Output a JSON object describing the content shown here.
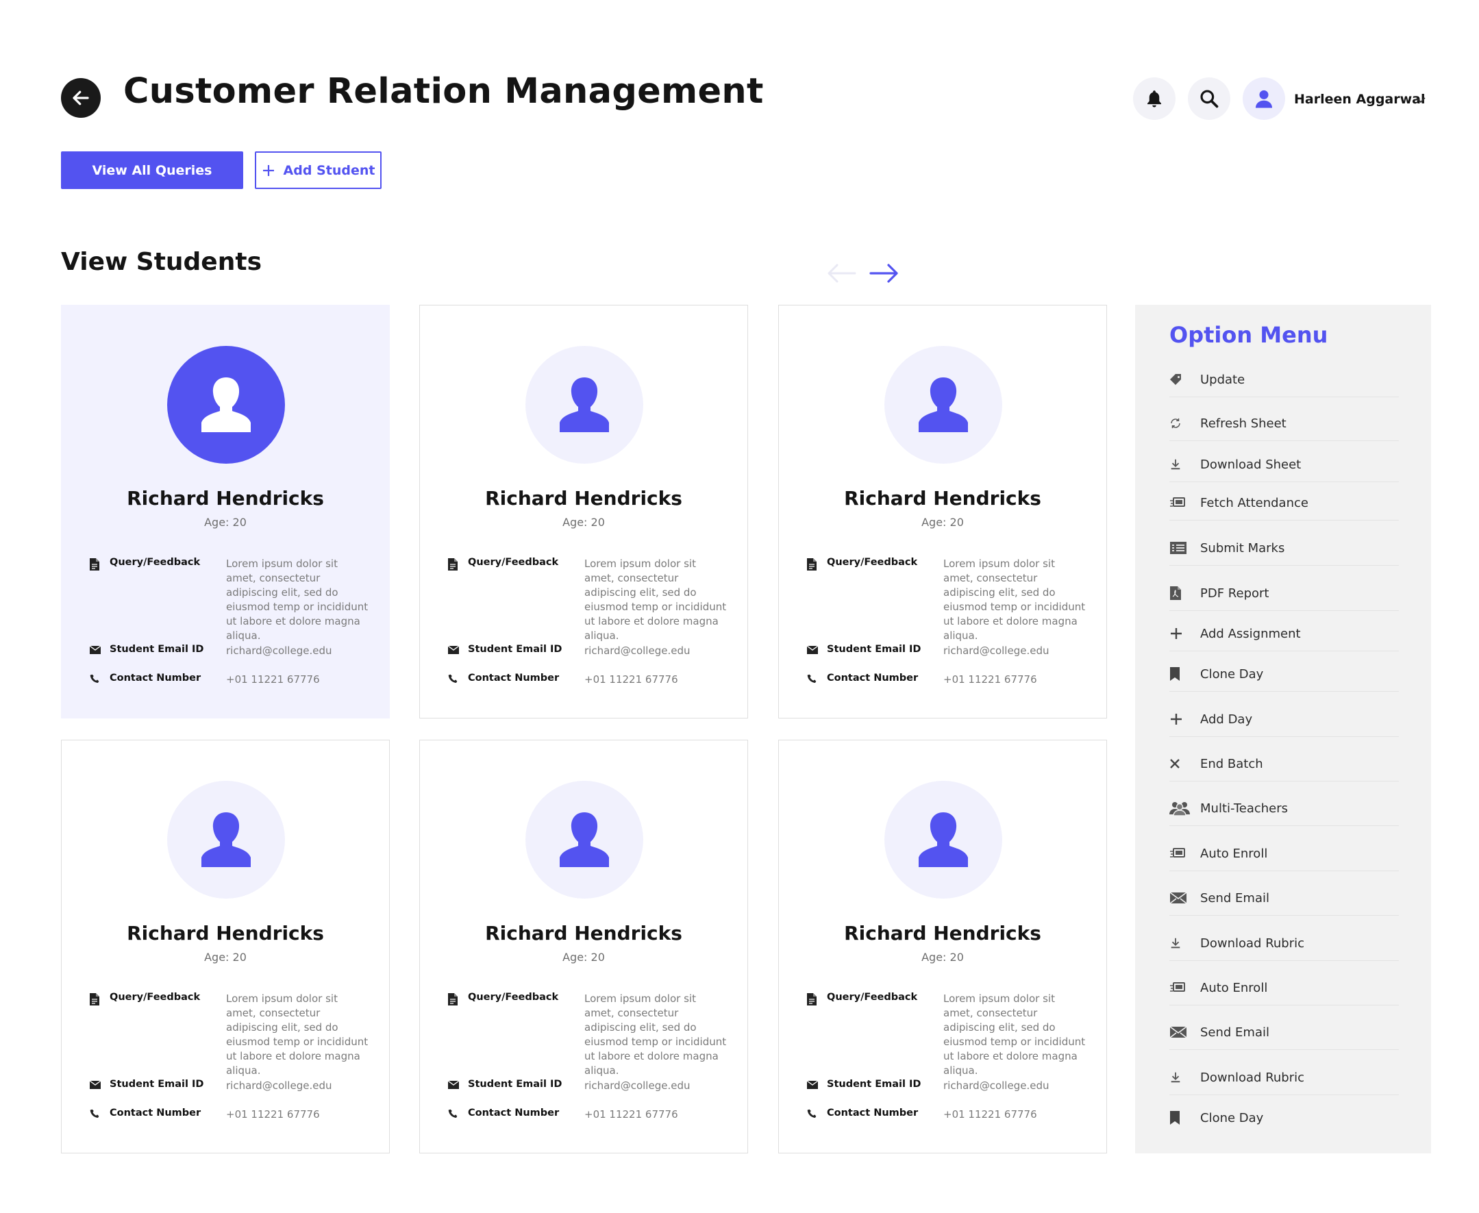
{
  "header": {
    "title": "Customer Relation Management",
    "user_name": "Harleen Aggarwal"
  },
  "actions": {
    "view_all_label": "View All Queries",
    "add_student_label": "Add Student"
  },
  "section_title": "View Students",
  "students": [
    {
      "name": "Richard Hendricks",
      "age": "Age: 20",
      "query_label": "Query/Feedback",
      "query_text": "Lorem ipsum dolor sit amet, consectetur adipiscing elit, sed do eiusmod temp or incididunt ut labore et dolore magna aliqua.",
      "email_label": "Student Email ID",
      "email": "richard@college.edu",
      "phone_label": "Contact Number",
      "phone": "+01 11221 67776"
    },
    {
      "name": "Richard Hendricks",
      "age": "Age: 20",
      "query_label": "Query/Feedback",
      "query_text": "Lorem ipsum dolor sit amet, consectetur adipiscing elit, sed do eiusmod temp or incididunt ut labore et dolore magna aliqua.",
      "email_label": "Student Email ID",
      "email": "richard@college.edu",
      "phone_label": "Contact Number",
      "phone": "+01 11221 67776"
    },
    {
      "name": "Richard Hendricks",
      "age": "Age: 20",
      "query_label": "Query/Feedback",
      "query_text": "Lorem ipsum dolor sit amet, consectetur adipiscing elit, sed do eiusmod temp or incididunt ut labore et dolore magna aliqua.",
      "email_label": "Student Email ID",
      "email": "richard@college.edu",
      "phone_label": "Contact Number",
      "phone": "+01 11221 67776"
    },
    {
      "name": "Richard Hendricks",
      "age": "Age: 20",
      "query_label": "Query/Feedback",
      "query_text": "Lorem ipsum dolor sit amet, consectetur adipiscing elit, sed do eiusmod temp or incididunt ut labore et dolore magna aliqua.",
      "email_label": "Student Email ID",
      "email": "richard@college.edu",
      "phone_label": "Contact Number",
      "phone": "+01 11221 67776"
    },
    {
      "name": "Richard Hendricks",
      "age": "Age: 20",
      "query_label": "Query/Feedback",
      "query_text": "Lorem ipsum dolor sit amet, consectetur adipiscing elit, sed do eiusmod temp or incididunt ut labore et dolore magna aliqua.",
      "email_label": "Student Email ID",
      "email": "richard@college.edu",
      "phone_label": "Contact Number",
      "phone": "+01 11221 67776"
    },
    {
      "name": "Richard Hendricks",
      "age": "Age: 20",
      "query_label": "Query/Feedback",
      "query_text": "Lorem ipsum dolor sit amet, consectetur adipiscing elit, sed do eiusmod temp or incididunt ut labore et dolore magna aliqua.",
      "email_label": "Student Email ID",
      "email": "richard@college.edu",
      "phone_label": "Contact Number",
      "phone": "+01 11221 67776"
    }
  ],
  "option_menu": {
    "title": "Option Menu",
    "items": [
      {
        "label": "Update",
        "icon": "tag-icon"
      },
      {
        "label": "Refresh Sheet",
        "icon": "refresh-icon"
      },
      {
        "label": "Download Sheet",
        "icon": "download-icon"
      },
      {
        "label": "Fetch Attendance",
        "icon": "fetch-icon"
      },
      {
        "label": "Submit Marks",
        "icon": "list-icon"
      },
      {
        "label": "PDF Report",
        "icon": "pdf-icon"
      },
      {
        "label": "Add Assignment",
        "icon": "plus-icon"
      },
      {
        "label": "Clone Day",
        "icon": "bookmark-icon"
      },
      {
        "label": "Add Day",
        "icon": "plus-icon"
      },
      {
        "label": "End Batch",
        "icon": "close-icon"
      },
      {
        "label": "Multi-Teachers",
        "icon": "users-icon"
      },
      {
        "label": "Auto Enroll",
        "icon": "fetch-icon"
      },
      {
        "label": "Send Email",
        "icon": "mail-icon"
      },
      {
        "label": "Download Rubric",
        "icon": "download-icon"
      },
      {
        "label": "Auto Enroll",
        "icon": "fetch-icon"
      },
      {
        "label": "Send Email",
        "icon": "mail-icon"
      },
      {
        "label": "Download Rubric",
        "icon": "download-icon"
      },
      {
        "label": "Clone Day",
        "icon": "bookmark-icon"
      }
    ]
  },
  "colors": {
    "accent": "#5353f0",
    "active_card_bg": "#f2f2fe",
    "panel_bg": "#f2f2f2"
  }
}
